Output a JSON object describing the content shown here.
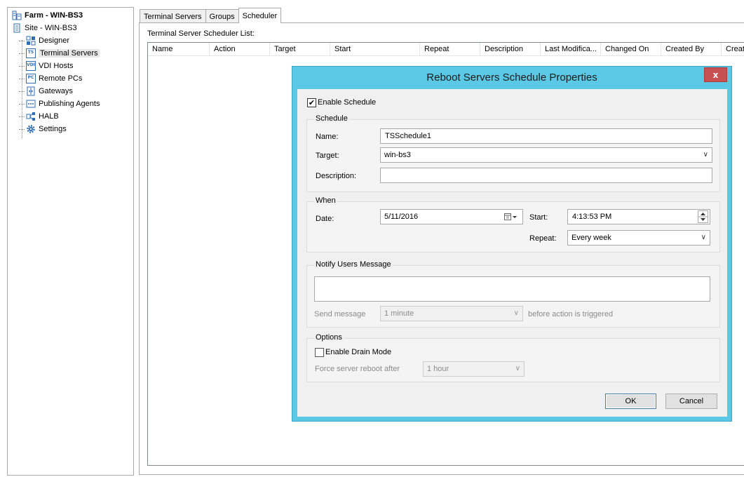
{
  "tree": {
    "farm": "Farm - WIN-BS3",
    "site": "Site - WIN-BS3",
    "items": [
      {
        "label": "Designer",
        "icon": "designer-icon"
      },
      {
        "label": "Terminal Servers",
        "icon": "terminal-servers-icon",
        "badge": "TS"
      },
      {
        "label": "VDI Hosts",
        "icon": "vdi-hosts-icon",
        "badge": "VDI"
      },
      {
        "label": "Remote PCs",
        "icon": "remote-pcs-icon",
        "badge": "PC"
      },
      {
        "label": "Gateways",
        "icon": "gateways-icon"
      },
      {
        "label": "Publishing Agents",
        "icon": "publishing-agents-icon"
      },
      {
        "label": "HALB",
        "icon": "halb-icon"
      },
      {
        "label": "Settings",
        "icon": "gear-icon"
      }
    ]
  },
  "tabs": [
    {
      "label": "Terminal Servers"
    },
    {
      "label": "Groups"
    },
    {
      "label": "Scheduler"
    }
  ],
  "list": {
    "label": "Terminal Server Scheduler List:",
    "columns": [
      "Name",
      "Action",
      "Target",
      "Start",
      "Repeat",
      "Description",
      "Last Modifica...",
      "Changed On",
      "Created By",
      "Creat"
    ]
  },
  "dialog": {
    "title": "Reboot Servers Schedule Properties",
    "close_glyph": "x",
    "enable_schedule": {
      "label": "Enable Schedule",
      "checked": true,
      "mark": "✔"
    },
    "schedule": {
      "title": "Schedule",
      "name_label": "Name:",
      "name_value": "TSSchedule1",
      "target_label": "Target:",
      "target_value": "win-bs3",
      "description_label": "Description:",
      "description_value": ""
    },
    "when": {
      "title": "When",
      "date_label": "Date:",
      "date_value": "5/11/2016",
      "start_label": "Start:",
      "start_value": "4:13:53 PM",
      "repeat_label": "Repeat:",
      "repeat_value": "Every week"
    },
    "notify": {
      "title": "Notify Users Message",
      "message_value": "",
      "send_label": "Send message",
      "send_value": "1 minute",
      "send_suffix": "before action is triggered"
    },
    "options": {
      "title": "Options",
      "drain_label": "Enable Drain Mode",
      "drain_checked": false,
      "force_label": "Force server reboot after",
      "force_value": "1 hour"
    },
    "ok_label": "OK",
    "cancel_label": "Cancel"
  },
  "colors": {
    "dialog_frame": "#5bc9e6",
    "close_button": "#c75050"
  }
}
